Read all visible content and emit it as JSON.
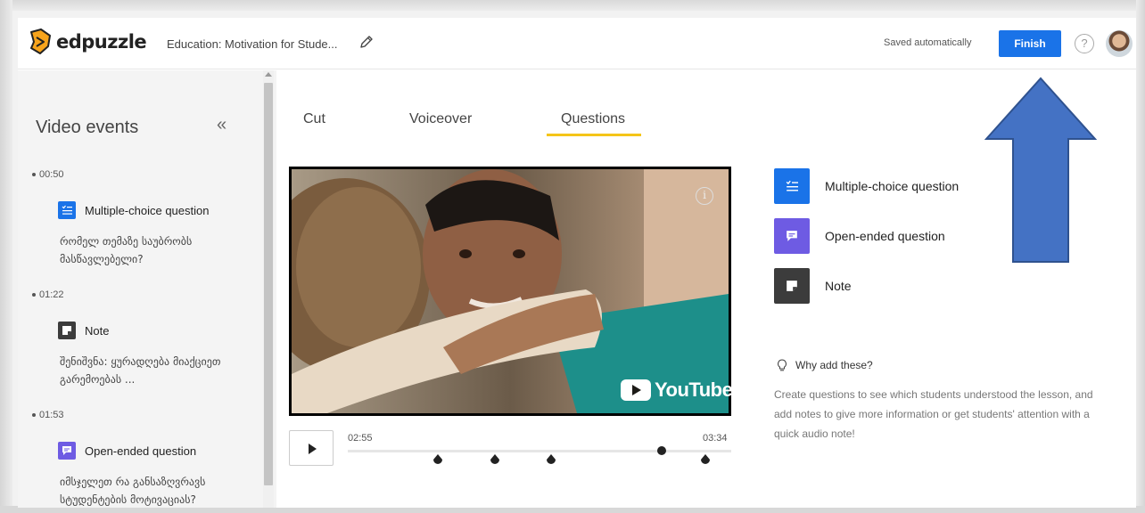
{
  "app": {
    "brand": "edpuzzle",
    "lesson_title": "Education: Motivation for Stude...",
    "saved_status": "Saved automatically",
    "finish_label": "Finish",
    "help_label": "?"
  },
  "sidebar": {
    "title": "Video events",
    "collapse_label": "«",
    "events": [
      {
        "time": "00:50",
        "type": "Multiple-choice question",
        "icon": "multiple-choice-icon",
        "color": "#1a73e8",
        "text": "რომელ თემაზე საუბრობს მასწავლებელი?"
      },
      {
        "time": "01:22",
        "type": "Note",
        "icon": "note-icon",
        "color": "#3c3c3c",
        "text": "შენიშვნა: ყურადღება მიაქციეთ გარემოებას ..."
      },
      {
        "time": "01:53",
        "type": "Open-ended question",
        "icon": "open-ended-icon",
        "color": "#6e5be3",
        "text": "იმსჯელეთ რა განსაზღვრავს სტუდენტების მოტივაციას?"
      }
    ]
  },
  "tabs": [
    {
      "label": "Cut",
      "active": false
    },
    {
      "label": "Voiceover",
      "active": false
    },
    {
      "label": "Questions",
      "active": true
    }
  ],
  "player": {
    "current_time": "02:55",
    "duration": "03:34",
    "watermark": "YouTube",
    "info_label": "i"
  },
  "add_panel": {
    "items": [
      {
        "label": "Multiple-choice question",
        "icon": "multiple-choice-icon",
        "color": "#1a73e8"
      },
      {
        "label": "Open-ended question",
        "icon": "open-ended-icon",
        "color": "#6e5be3"
      },
      {
        "label": "Note",
        "icon": "note-icon",
        "color": "#3c3c3c"
      }
    ],
    "why_title": "Why add these?",
    "why_text": "Create questions to see which students understood the lesson, and add notes to give more information or get students' attention with a quick audio note!"
  },
  "annotation": {
    "arrow_color": "#4472c4"
  }
}
